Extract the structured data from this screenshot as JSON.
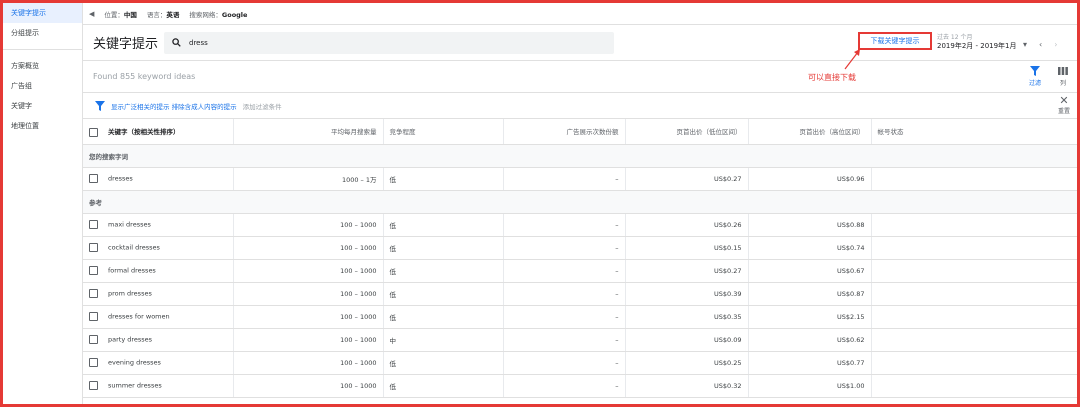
{
  "sidebar": {
    "items": [
      {
        "label": "关键字提示"
      },
      {
        "label": "分组提示"
      },
      {
        "label": "方案概览"
      },
      {
        "label": "广告组"
      },
      {
        "label": "关键字"
      },
      {
        "label": "地理位置"
      }
    ]
  },
  "filterbar": {
    "location_label": "位置：",
    "location_value": "中国",
    "language_label": "语言：",
    "language_value": "英语",
    "network_label": "搜索网络：",
    "network_value": "Google"
  },
  "header": {
    "title": "关键字提示",
    "search_value": "dress",
    "download_label": "下载关键字提示",
    "date_label": "过去 12 个月",
    "date_value": "2019年2月 - 2019年1月"
  },
  "annotation": {
    "text": "可以直接下载"
  },
  "results": {
    "found_text": "Found 855 keyword ideas",
    "filter_label": "过滤",
    "columns_label": "列"
  },
  "chips": {
    "link_text": "显示广泛相关的提示 排除含成人内容的提示",
    "add_text": "添加过滤条件",
    "reset_label": "重置"
  },
  "table": {
    "headers": [
      "关键字（按相关性排序）",
      "平均每月搜索量",
      "竞争程度",
      "广告展示次数份额",
      "页首出价（低位区间）",
      "页首出价（高位区间）",
      "帐号状态"
    ],
    "group1_label": "您的搜索字词",
    "group2_label": "参考",
    "rows": [
      {
        "keyword": "dresses",
        "searches": "1000 – 1万",
        "competition": "低",
        "share": "–",
        "low": "US$0.27",
        "high": "US$0.96"
      },
      {
        "keyword": "maxi dresses",
        "searches": "100 – 1000",
        "competition": "低",
        "share": "–",
        "low": "US$0.26",
        "high": "US$0.88"
      },
      {
        "keyword": "cocktail dresses",
        "searches": "100 – 1000",
        "competition": "低",
        "share": "–",
        "low": "US$0.15",
        "high": "US$0.74"
      },
      {
        "keyword": "formal dresses",
        "searches": "100 – 1000",
        "competition": "低",
        "share": "–",
        "low": "US$0.27",
        "high": "US$0.67"
      },
      {
        "keyword": "prom dresses",
        "searches": "100 – 1000",
        "competition": "低",
        "share": "–",
        "low": "US$0.39",
        "high": "US$0.87"
      },
      {
        "keyword": "dresses for women",
        "searches": "100 – 1000",
        "competition": "低",
        "share": "–",
        "low": "US$0.35",
        "high": "US$2.15"
      },
      {
        "keyword": "party dresses",
        "searches": "100 – 1000",
        "competition": "中",
        "share": "–",
        "low": "US$0.09",
        "high": "US$0.62"
      },
      {
        "keyword": "evening dresses",
        "searches": "100 – 1000",
        "competition": "低",
        "share": "–",
        "low": "US$0.25",
        "high": "US$0.77"
      },
      {
        "keyword": "summer dresses",
        "searches": "100 – 1000",
        "competition": "低",
        "share": "–",
        "low": "US$0.32",
        "high": "US$1.00"
      }
    ]
  },
  "colors": {
    "accent": "#1a73e8",
    "annotation": "#e53935"
  }
}
